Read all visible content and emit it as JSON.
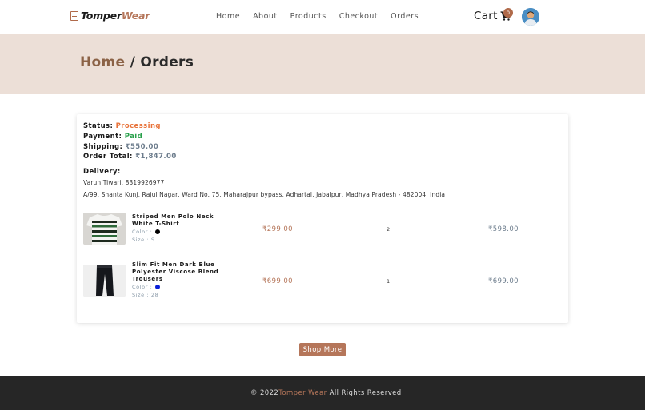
{
  "brand": {
    "name_part1": "Tomper",
    "name_part2": "Wear",
    "accent_color": "#b5765a"
  },
  "nav": {
    "items": [
      {
        "label": "Home"
      },
      {
        "label": "About"
      },
      {
        "label": "Products"
      },
      {
        "label": "Checkout"
      },
      {
        "label": "Orders"
      }
    ]
  },
  "cart": {
    "label": "Cart",
    "count": "0",
    "icon": "cart-icon"
  },
  "user": {
    "avatar_icon": "avatar"
  },
  "breadcrumb": {
    "home": "Home",
    "separator": "/",
    "current": "Orders"
  },
  "order": {
    "status_label": "Status:",
    "status_value": "Processing",
    "status_color": "#e8733a",
    "payment_label": "Payment:",
    "payment_value": "Paid",
    "payment_color": "#27a04a",
    "shipping_label": "Shipping:",
    "shipping_value": "₹550.00",
    "total_label": "Order Total:",
    "total_value": "₹1,847.00",
    "delivery_label": "Delivery:",
    "delivery_contact": "Varun Tiwari, 8319926977",
    "delivery_address": "A/99, Shanta Kunj, Rajul Nagar, Ward No. 75, Maharajpur bypass, Adhartal, Jabalpur, Madhya Pradesh - 482004, India",
    "items": [
      {
        "name": "Striped Men Polo Neck White T-Shirt",
        "color_label": "Color :",
        "color_value": "#000000",
        "size_label": "Size : S",
        "price": "₹299.00",
        "qty": "2",
        "total": "₹598.00"
      },
      {
        "name": "Slim Fit Men Dark Blue Polyester Viscose Blend Trousers",
        "color_label": "Color :",
        "color_value": "#0a1fd8",
        "size_label": "Size : 28",
        "price": "₹699.00",
        "qty": "1",
        "total": "₹699.00"
      }
    ]
  },
  "shop_more": {
    "label": "Shop More"
  },
  "footer": {
    "prefix": "© 2022",
    "brand": "Tomper Wear",
    "suffix": "All Rights Reserved"
  }
}
